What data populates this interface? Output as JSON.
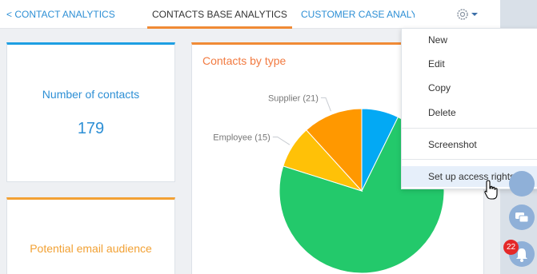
{
  "tabs": {
    "left": "< CONTACT ANALYTICS",
    "active": "CONTACTS BASE ANALYTICS",
    "right": "CUSTOMER CASE ANALY >"
  },
  "widgets": {
    "contacts": {
      "title": "Number of contacts",
      "value": "179"
    },
    "email": {
      "title": "Potential email audience"
    },
    "pie": {
      "title": "Contacts by type"
    }
  },
  "menu": {
    "items": [
      "New",
      "Edit",
      "Copy",
      "Delete",
      "Screenshot",
      "Set up access rights"
    ],
    "hovered": "Set up access rights"
  },
  "notifications": {
    "badge": "22"
  },
  "chart_data": {
    "type": "pie",
    "title": "Contacts by type",
    "slices": [
      {
        "label": "Supplier (21)",
        "value": 21,
        "color": "#ff9800"
      },
      {
        "label": "Employee (15)",
        "value": 15,
        "color": "#ffc107"
      },
      {
        "label": "",
        "value": 13,
        "color": "#03a9f4"
      },
      {
        "label": "",
        "value": 130,
        "color": "#23c96b"
      }
    ]
  },
  "colors": {
    "accent_blue": "#2d8fd5",
    "accent_orange": "#f08a35",
    "badge_red": "#e42828"
  }
}
